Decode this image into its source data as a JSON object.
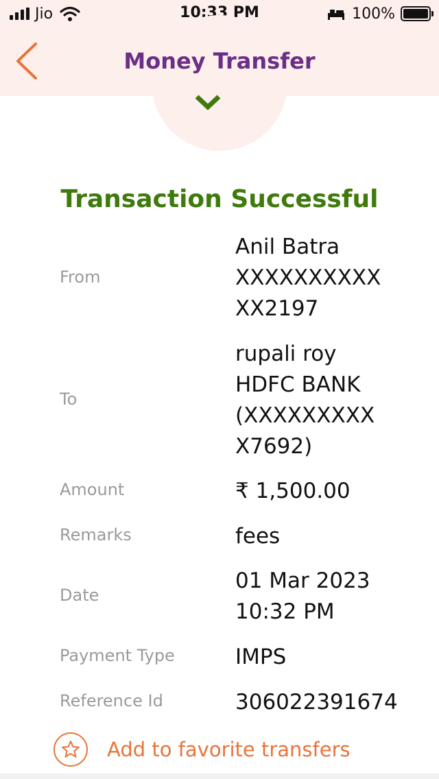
{
  "status_bar": {
    "carrier": "Jio",
    "time": "10:33 PM",
    "battery": "100%"
  },
  "header": {
    "title": "Money Transfer"
  },
  "result": {
    "message": "Transaction Successful"
  },
  "details": {
    "from": {
      "label": "From",
      "line1": "Anil Batra",
      "line2": "XXXXXXXXXX",
      "line3": "XX2197"
    },
    "to": {
      "label": "To",
      "line1": "rupali roy",
      "line2": "HDFC BANK",
      "line3": "(XXXXXXXXX",
      "line4": "X7692)"
    },
    "amount": {
      "label": "Amount",
      "value": "₹ 1,500.00"
    },
    "remarks": {
      "label": "Remarks",
      "value": "fees"
    },
    "date": {
      "label": "Date",
      "line1": "01 Mar 2023",
      "line2": "10:32 PM"
    },
    "payment_type": {
      "label": "Payment Type",
      "value": "IMPS"
    },
    "reference_id": {
      "label": "Reference Id",
      "value": "306022391674"
    }
  },
  "actions": {
    "add_favorite": "Add to favorite transfers"
  },
  "colors": {
    "header_bg": "#fdefec",
    "title": "#6b2f86",
    "success": "#3f7a0c",
    "accent": "#e8743a",
    "label": "#9a9a9a"
  },
  "icons": {
    "back": "chevron-left-icon",
    "status": "chevron-down-icon",
    "favorite": "star-icon"
  }
}
